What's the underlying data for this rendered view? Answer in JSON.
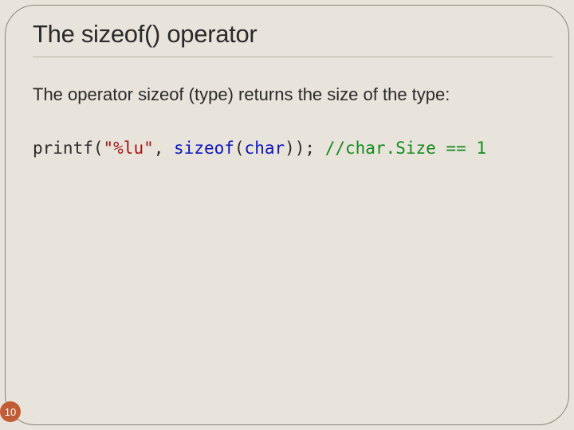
{
  "slide": {
    "title": "The sizeof() operator",
    "body": "The operator sizeof (type) returns the size of the type:",
    "code": {
      "plain1": "printf(",
      "string": "\"%lu\"",
      "plain2": ", ",
      "keyword1": "sizeof",
      "plain3": "(",
      "keyword2": "char",
      "plain4": ")); ",
      "comment": "//char.Size == 1"
    },
    "page_number": "10"
  }
}
